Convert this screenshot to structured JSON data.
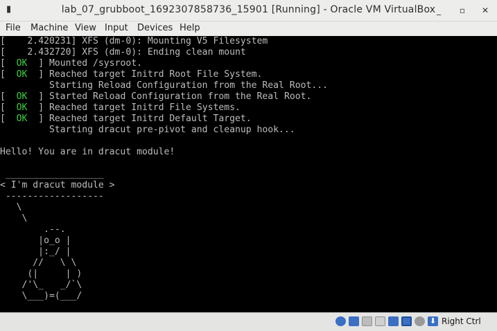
{
  "window": {
    "title": "lab_07_grubboot_1692307858736_15901 [Running] - Oracle VM VirtualBox",
    "icon": "window-menu-icon",
    "buttons": {
      "minimize": "_",
      "maximize": "▫",
      "close": "✕"
    }
  },
  "menu": [
    "File",
    "Machine",
    "View",
    "Input",
    "Devices",
    "Help"
  ],
  "console": {
    "ok_label": "OK",
    "lines": [
      {
        "prefix": "[    ",
        "status": "",
        "text": "2.420231] XFS (dm-0): Mounting V5 Filesystem"
      },
      {
        "prefix": "[    ",
        "status": "",
        "text": "2.432720] XFS (dm-0): Ending clean mount"
      },
      {
        "prefix": "[  ",
        "status": "OK",
        "text": "  ] Mounted /sysroot."
      },
      {
        "prefix": "[  ",
        "status": "OK",
        "text": "  ] Reached target Initrd Root File System."
      },
      {
        "prefix": "",
        "status": "",
        "text": "         Starting Reload Configuration from the Real Root..."
      },
      {
        "prefix": "[  ",
        "status": "OK",
        "text": "  ] Started Reload Configuration from the Real Root."
      },
      {
        "prefix": "[  ",
        "status": "OK",
        "text": "  ] Reached target Initrd File Systems."
      },
      {
        "prefix": "[  ",
        "status": "OK",
        "text": "  ] Reached target Initrd Default Target."
      },
      {
        "prefix": "",
        "status": "",
        "text": "         Starting dracut pre-pivot and cleanup hook..."
      },
      {
        "prefix": "",
        "status": "",
        "text": ""
      },
      {
        "prefix": "",
        "status": "",
        "text": "Hello! You are in dracut module!"
      },
      {
        "prefix": "",
        "status": "",
        "text": ""
      },
      {
        "prefix": "",
        "status": "",
        "text": " __________________"
      },
      {
        "prefix": "",
        "status": "",
        "text": "< I'm dracut module >"
      },
      {
        "prefix": "",
        "status": "",
        "text": " ------------------"
      },
      {
        "prefix": "",
        "status": "",
        "text": "   \\"
      },
      {
        "prefix": "",
        "status": "",
        "text": "    \\"
      },
      {
        "prefix": "",
        "status": "",
        "text": "        .--."
      },
      {
        "prefix": "",
        "status": "",
        "text": "       |o_o |"
      },
      {
        "prefix": "",
        "status": "",
        "text": "       |:_/ |"
      },
      {
        "prefix": "",
        "status": "",
        "text": "      //   \\ \\"
      },
      {
        "prefix": "",
        "status": "",
        "text": "     (|     | )"
      },
      {
        "prefix": "",
        "status": "",
        "text": "    /'\\_   _/`\\"
      },
      {
        "prefix": "",
        "status": "",
        "text": "    \\___)=(___/"
      }
    ]
  },
  "statusbar": {
    "icons": [
      "harddisk-icon",
      "optical-drive-icon",
      "floppy-icon",
      "network-icon",
      "usb-icon",
      "shared-folders-icon",
      "display-icon",
      "recording-icon",
      "cpu-icon",
      "mouse-integration-icon"
    ],
    "host_key": "Right Ctrl",
    "colors": {
      "blue": "#3a6fc4",
      "gray": "#9a9a9a",
      "green": "#3aa640"
    }
  }
}
